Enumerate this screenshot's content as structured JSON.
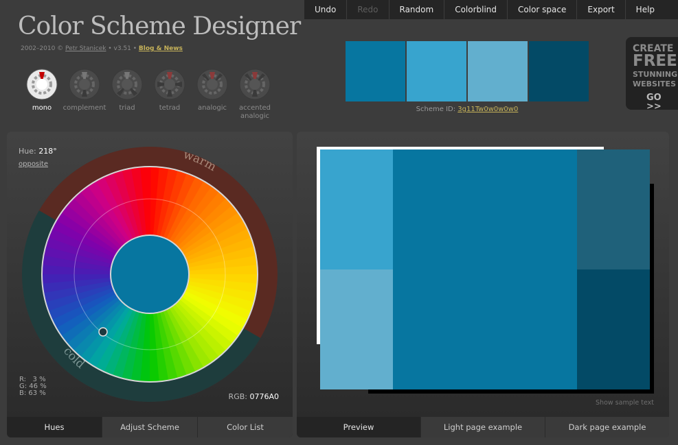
{
  "app": {
    "title": "Color Scheme Designer",
    "credits": {
      "years": "2002–2010 ©",
      "author": "Petr Stanicek",
      "version": "• v3.51 •",
      "news": "Blog & News"
    }
  },
  "menu": [
    {
      "label": "Undo",
      "enabled": true
    },
    {
      "label": "Redo",
      "enabled": false
    },
    {
      "label": "Random",
      "enabled": true
    },
    {
      "label": "Colorblind",
      "enabled": true
    },
    {
      "label": "Color space",
      "enabled": true
    },
    {
      "label": "Export",
      "enabled": true
    },
    {
      "label": "Help",
      "enabled": true
    }
  ],
  "modes": [
    {
      "label": "mono",
      "active": true,
      "icon": "mono-dial-icon"
    },
    {
      "label": "complement",
      "active": false,
      "icon": "complement-dial-icon"
    },
    {
      "label": "triad",
      "active": false,
      "icon": "triad-dial-icon"
    },
    {
      "label": "tetrad",
      "active": false,
      "icon": "tetrad-dial-icon"
    },
    {
      "label": "analogic",
      "active": false,
      "icon": "analogic-dial-icon"
    },
    {
      "label": "accented analogic",
      "active": false,
      "icon": "accented-analogic-dial-icon"
    }
  ],
  "palette": {
    "swatches": [
      "#0776A0",
      "#38A4CE",
      "#62AFCE",
      "#034A66"
    ],
    "scheme_id_label": "Scheme ID:",
    "scheme_id": "3g11Tw0w0w0w0"
  },
  "ad": {
    "line1": "CREATE",
    "line2": "FREE",
    "line3": "STUNNING",
    "line4": "WEBSITES",
    "cta": "GO >>"
  },
  "wheel": {
    "hue_label": "Hue:",
    "hue_value": "218°",
    "opposite": "opposite",
    "warm": "warm",
    "cold": "cold",
    "center_color": "#0776A0",
    "r": "R:   3 %",
    "g": "G: 46 %",
    "b": "B: 63 %",
    "rgb_label": "RGB:",
    "rgb_value": "0776A0"
  },
  "left_tabs": [
    {
      "label": "Hues",
      "active": true
    },
    {
      "label": "Adjust Scheme",
      "active": false
    },
    {
      "label": "Color List",
      "active": false
    }
  ],
  "preview": {
    "colors": {
      "primary": "#0776A0",
      "light": "#38A4CE",
      "lighter": "#62AFCE",
      "dark_muted": "#1F617A",
      "dark": "#034A66"
    },
    "show_sample_text": "Show sample text"
  },
  "right_tabs": [
    {
      "label": "Preview",
      "active": true
    },
    {
      "label": "Light page example",
      "active": false
    },
    {
      "label": "Dark page example",
      "active": false
    }
  ]
}
